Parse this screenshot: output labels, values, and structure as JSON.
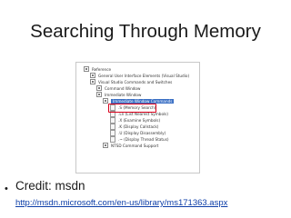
{
  "slide": {
    "title": "Searching Through Memory"
  },
  "tree": {
    "nodes": [
      {
        "id": "reference",
        "label": "Reference",
        "icon": "expander-icon"
      },
      {
        "id": "general-ui",
        "label": "General User Interface Elements (Visual Studio)",
        "icon": "expander-icon"
      },
      {
        "id": "commands-switches",
        "label": "Visual Studio Commands and Switches",
        "icon": "expander-icon"
      },
      {
        "id": "command-window",
        "label": "Command Window",
        "icon": "expander-icon"
      },
      {
        "id": "immediate-window",
        "label": "Immediate Window",
        "icon": "expander-icon"
      },
      {
        "id": "immediate-window-commands",
        "label": "Immediate Window Commands",
        "icon": "expander-icon",
        "selected": true
      },
      {
        "id": "memory-search",
        "label": ".S (Memory Search)",
        "icon": "page-icon",
        "highlighted": true
      },
      {
        "id": "list-nearest-symbols",
        "label": ".Ln (List Nearest Symbols)",
        "icon": "page-icon"
      },
      {
        "id": "examine-symbols",
        "label": ".X (Examine Symbols)",
        "icon": "page-icon"
      },
      {
        "id": "display-callstack",
        "label": ".K (Display Callstack)",
        "icon": "page-icon"
      },
      {
        "id": "display-disassembly",
        "label": ".U (Display Disassembly)",
        "icon": "page-icon"
      },
      {
        "id": "display-thread-status",
        "label": ".~ (Display Thread Status)",
        "icon": "page-icon"
      },
      {
        "id": "ntsd-command-support",
        "label": "NTSD Command Support",
        "icon": "expander-icon"
      }
    ]
  },
  "credit": {
    "bullet": "•",
    "label": "Credit: msdn",
    "link": "http://msdn.microsoft.com/en-us/library/ms171363.aspx"
  },
  "colors": {
    "highlight": "#d9001b",
    "selection": "#3a6fc4",
    "link": "#0d3ea8"
  }
}
